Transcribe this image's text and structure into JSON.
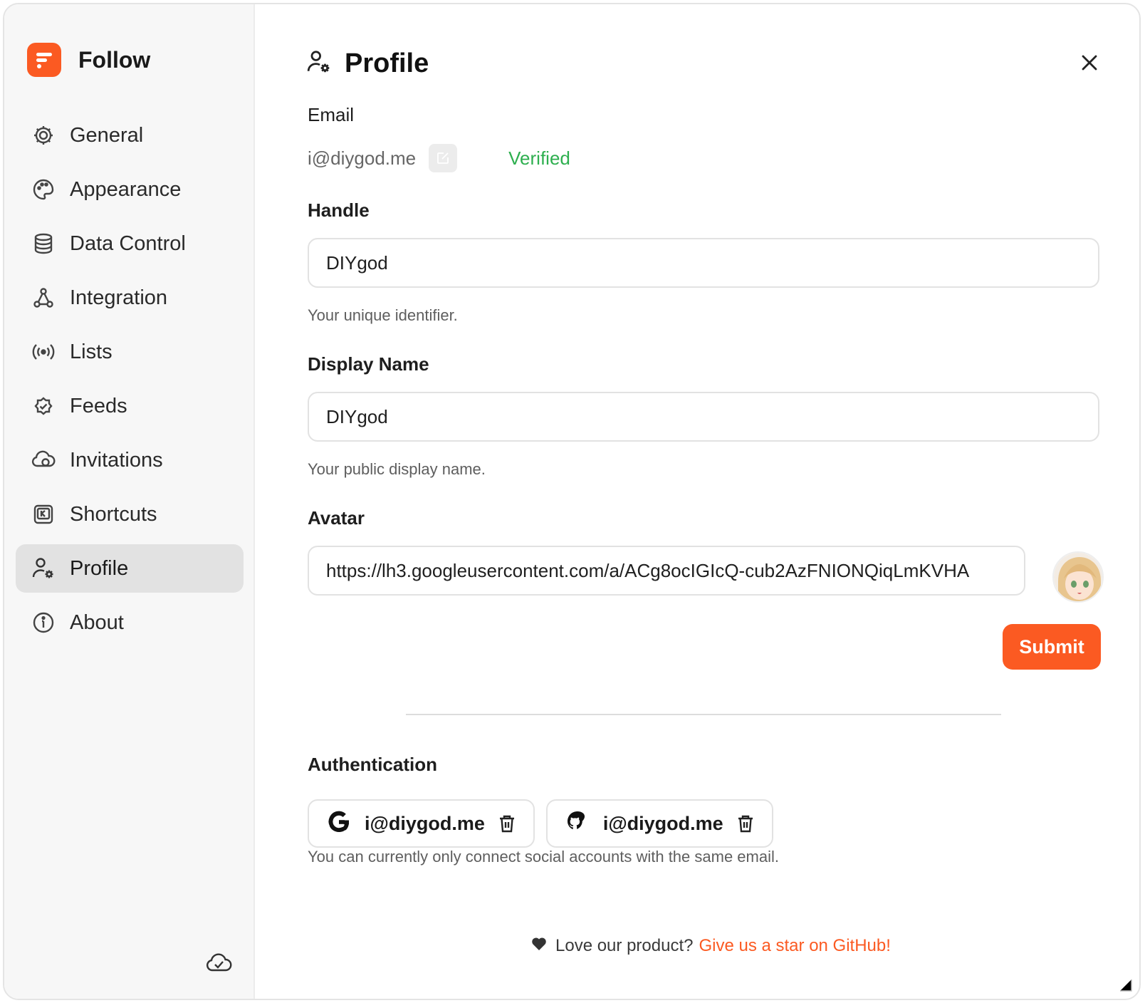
{
  "app": {
    "name": "Follow",
    "accent": "#fb5a22"
  },
  "sidebar": {
    "items": [
      {
        "label": "General",
        "icon": "gear-icon"
      },
      {
        "label": "Appearance",
        "icon": "palette-icon"
      },
      {
        "label": "Data Control",
        "icon": "database-icon"
      },
      {
        "label": "Integration",
        "icon": "integration-icon"
      },
      {
        "label": "Lists",
        "icon": "broadcast-icon"
      },
      {
        "label": "Feeds",
        "icon": "verified-badge-icon"
      },
      {
        "label": "Invitations",
        "icon": "invitation-icon"
      },
      {
        "label": "Shortcuts",
        "icon": "keyboard-icon"
      },
      {
        "label": "Profile",
        "icon": "user-settings-icon",
        "active": true
      },
      {
        "label": "About",
        "icon": "info-icon"
      }
    ]
  },
  "page": {
    "title": "Profile"
  },
  "email": {
    "label": "Email",
    "value": "i@diygod.me",
    "status": "Verified"
  },
  "handle": {
    "label": "Handle",
    "value": "DIYgod",
    "help": "Your unique identifier."
  },
  "display_name": {
    "label": "Display Name",
    "value": "DIYgod",
    "help": "Your public display name."
  },
  "avatar": {
    "label": "Avatar",
    "value": "https://lh3.googleusercontent.com/a/ACg8ocIGIcQ-cub2AzFNIONQiqLmKVHA"
  },
  "submit_label": "Submit",
  "authentication": {
    "label": "Authentication",
    "accounts": [
      {
        "provider_icon": "google-icon",
        "email": "i@diygod.me"
      },
      {
        "provider_icon": "github-icon",
        "email": "i@diygod.me"
      }
    ],
    "help": "You can currently only connect social accounts with the same email."
  },
  "footer": {
    "text": "Love our product?",
    "link": "Give us a star on GitHub!"
  }
}
